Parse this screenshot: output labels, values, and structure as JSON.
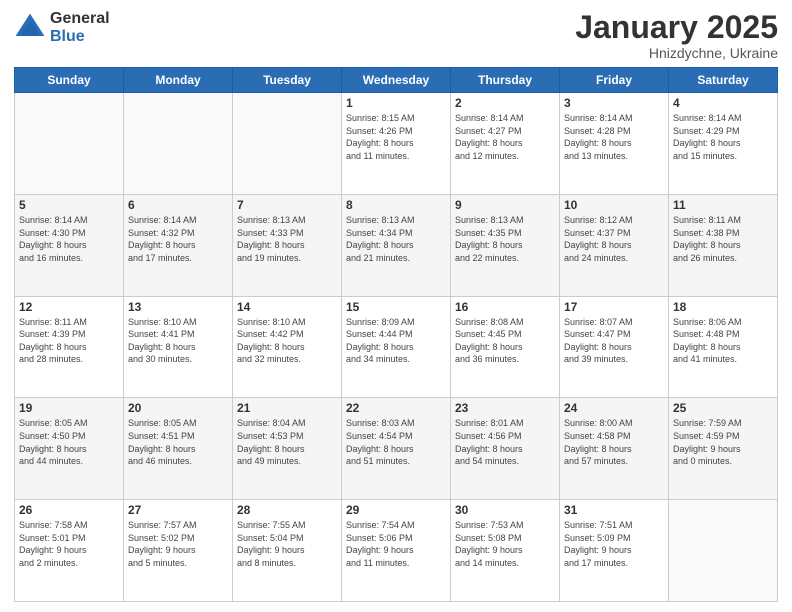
{
  "logo": {
    "general": "General",
    "blue": "Blue"
  },
  "title": "January 2025",
  "location": "Hnizdychne, Ukraine",
  "days_of_week": [
    "Sunday",
    "Monday",
    "Tuesday",
    "Wednesday",
    "Thursday",
    "Friday",
    "Saturday"
  ],
  "weeks": [
    [
      {
        "num": "",
        "info": ""
      },
      {
        "num": "",
        "info": ""
      },
      {
        "num": "",
        "info": ""
      },
      {
        "num": "1",
        "info": "Sunrise: 8:15 AM\nSunset: 4:26 PM\nDaylight: 8 hours\nand 11 minutes."
      },
      {
        "num": "2",
        "info": "Sunrise: 8:14 AM\nSunset: 4:27 PM\nDaylight: 8 hours\nand 12 minutes."
      },
      {
        "num": "3",
        "info": "Sunrise: 8:14 AM\nSunset: 4:28 PM\nDaylight: 8 hours\nand 13 minutes."
      },
      {
        "num": "4",
        "info": "Sunrise: 8:14 AM\nSunset: 4:29 PM\nDaylight: 8 hours\nand 15 minutes."
      }
    ],
    [
      {
        "num": "5",
        "info": "Sunrise: 8:14 AM\nSunset: 4:30 PM\nDaylight: 8 hours\nand 16 minutes."
      },
      {
        "num": "6",
        "info": "Sunrise: 8:14 AM\nSunset: 4:32 PM\nDaylight: 8 hours\nand 17 minutes."
      },
      {
        "num": "7",
        "info": "Sunrise: 8:13 AM\nSunset: 4:33 PM\nDaylight: 8 hours\nand 19 minutes."
      },
      {
        "num": "8",
        "info": "Sunrise: 8:13 AM\nSunset: 4:34 PM\nDaylight: 8 hours\nand 21 minutes."
      },
      {
        "num": "9",
        "info": "Sunrise: 8:13 AM\nSunset: 4:35 PM\nDaylight: 8 hours\nand 22 minutes."
      },
      {
        "num": "10",
        "info": "Sunrise: 8:12 AM\nSunset: 4:37 PM\nDaylight: 8 hours\nand 24 minutes."
      },
      {
        "num": "11",
        "info": "Sunrise: 8:11 AM\nSunset: 4:38 PM\nDaylight: 8 hours\nand 26 minutes."
      }
    ],
    [
      {
        "num": "12",
        "info": "Sunrise: 8:11 AM\nSunset: 4:39 PM\nDaylight: 8 hours\nand 28 minutes."
      },
      {
        "num": "13",
        "info": "Sunrise: 8:10 AM\nSunset: 4:41 PM\nDaylight: 8 hours\nand 30 minutes."
      },
      {
        "num": "14",
        "info": "Sunrise: 8:10 AM\nSunset: 4:42 PM\nDaylight: 8 hours\nand 32 minutes."
      },
      {
        "num": "15",
        "info": "Sunrise: 8:09 AM\nSunset: 4:44 PM\nDaylight: 8 hours\nand 34 minutes."
      },
      {
        "num": "16",
        "info": "Sunrise: 8:08 AM\nSunset: 4:45 PM\nDaylight: 8 hours\nand 36 minutes."
      },
      {
        "num": "17",
        "info": "Sunrise: 8:07 AM\nSunset: 4:47 PM\nDaylight: 8 hours\nand 39 minutes."
      },
      {
        "num": "18",
        "info": "Sunrise: 8:06 AM\nSunset: 4:48 PM\nDaylight: 8 hours\nand 41 minutes."
      }
    ],
    [
      {
        "num": "19",
        "info": "Sunrise: 8:05 AM\nSunset: 4:50 PM\nDaylight: 8 hours\nand 44 minutes."
      },
      {
        "num": "20",
        "info": "Sunrise: 8:05 AM\nSunset: 4:51 PM\nDaylight: 8 hours\nand 46 minutes."
      },
      {
        "num": "21",
        "info": "Sunrise: 8:04 AM\nSunset: 4:53 PM\nDaylight: 8 hours\nand 49 minutes."
      },
      {
        "num": "22",
        "info": "Sunrise: 8:03 AM\nSunset: 4:54 PM\nDaylight: 8 hours\nand 51 minutes."
      },
      {
        "num": "23",
        "info": "Sunrise: 8:01 AM\nSunset: 4:56 PM\nDaylight: 8 hours\nand 54 minutes."
      },
      {
        "num": "24",
        "info": "Sunrise: 8:00 AM\nSunset: 4:58 PM\nDaylight: 8 hours\nand 57 minutes."
      },
      {
        "num": "25",
        "info": "Sunrise: 7:59 AM\nSunset: 4:59 PM\nDaylight: 9 hours\nand 0 minutes."
      }
    ],
    [
      {
        "num": "26",
        "info": "Sunrise: 7:58 AM\nSunset: 5:01 PM\nDaylight: 9 hours\nand 2 minutes."
      },
      {
        "num": "27",
        "info": "Sunrise: 7:57 AM\nSunset: 5:02 PM\nDaylight: 9 hours\nand 5 minutes."
      },
      {
        "num": "28",
        "info": "Sunrise: 7:55 AM\nSunset: 5:04 PM\nDaylight: 9 hours\nand 8 minutes."
      },
      {
        "num": "29",
        "info": "Sunrise: 7:54 AM\nSunset: 5:06 PM\nDaylight: 9 hours\nand 11 minutes."
      },
      {
        "num": "30",
        "info": "Sunrise: 7:53 AM\nSunset: 5:08 PM\nDaylight: 9 hours\nand 14 minutes."
      },
      {
        "num": "31",
        "info": "Sunrise: 7:51 AM\nSunset: 5:09 PM\nDaylight: 9 hours\nand 17 minutes."
      },
      {
        "num": "",
        "info": ""
      }
    ]
  ]
}
